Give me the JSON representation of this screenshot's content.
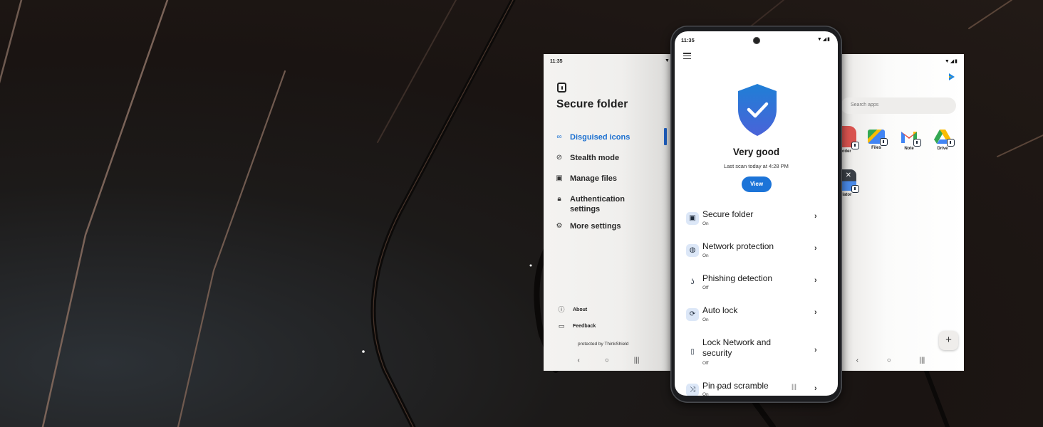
{
  "background": {
    "description": "dark brown abstract curved phone edges"
  },
  "left_panel": {
    "status_time": "11:35",
    "title": "Secure folder",
    "menu": [
      {
        "icon": "mask-icon",
        "label": "Disguised icons",
        "active": true
      },
      {
        "icon": "eye-off-icon",
        "label": "Stealth mode",
        "active": false
      },
      {
        "icon": "folder-icon",
        "label": "Manage files",
        "active": false
      },
      {
        "icon": "lock-icon",
        "label": "Authentication settings",
        "active": false
      },
      {
        "icon": "gear-icon",
        "label": "More settings",
        "active": false
      }
    ],
    "footer_items": [
      {
        "icon": "info-icon",
        "label": "About"
      },
      {
        "icon": "feedback-icon",
        "label": "Feedback"
      }
    ],
    "protected_by": "protected by ThinkShield",
    "nav": {
      "back": "‹",
      "home": "○",
      "recents": "|||"
    }
  },
  "center_phone": {
    "status_time": "11:35",
    "status_title": "Very good",
    "last_scan": "Last scan today at 4:28 PM",
    "view_button": "View",
    "accent_color": "#1c74d8",
    "features": [
      {
        "icon": "secure-folder-icon",
        "title": "Secure folder",
        "state": "On"
      },
      {
        "icon": "network-protection-icon",
        "title": "Network protection",
        "state": "On"
      },
      {
        "icon": "phishing-hook-icon",
        "title": "Phishing detection",
        "state": "Off"
      },
      {
        "icon": "auto-lock-icon",
        "title": "Auto lock",
        "state": "On"
      },
      {
        "icon": "phone-lock-icon",
        "title": "Lock Network and security",
        "state": "Off"
      },
      {
        "icon": "shuffle-icon",
        "title": "Pin pad scramble",
        "state": "On"
      }
    ]
  },
  "right_panel": {
    "search_placeholder": "Search apps",
    "apps": [
      {
        "label": "Recorder",
        "visible_label": "order",
        "color": "#d9534f"
      },
      {
        "label": "Files",
        "visible_label": "Files",
        "color": "#4285f4"
      },
      {
        "label": "Note",
        "visible_label": "Note",
        "color": "#ea4335"
      },
      {
        "label": "Drive",
        "visible_label": "Drive",
        "color": "#34a853"
      },
      {
        "label": "Calculator",
        "visible_label": "ulator",
        "color": "#3a3f46"
      }
    ],
    "add_button": "+",
    "nav": {
      "back": "‹",
      "home": "○",
      "recents": "|||"
    }
  }
}
